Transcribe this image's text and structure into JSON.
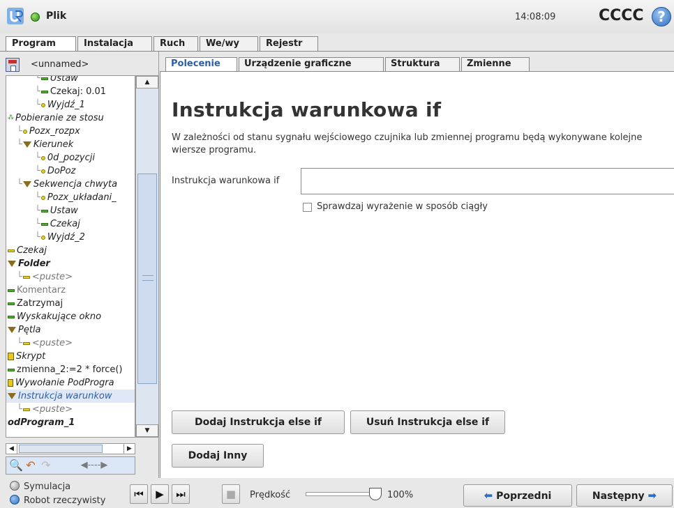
{
  "header": {
    "file_menu": "Plik",
    "clock": "14:08:09",
    "robot_name": "CCCC",
    "help_symbol": "?"
  },
  "main_tabs": [
    "Program",
    "Instalacja",
    "Ruch",
    "We/wy",
    "Rejestr"
  ],
  "program": {
    "name": "<unnamed>"
  },
  "tree": [
    {
      "label": "Ustaw",
      "indent": 3,
      "icon": "bar-icon",
      "style": ""
    },
    {
      "label": "Czekaj: 0.01",
      "indent": 3,
      "icon": "bar-icon",
      "style": "plain"
    },
    {
      "label": "Wyjdź_1",
      "indent": 3,
      "icon": "dot-icon",
      "style": ""
    },
    {
      "label": "Pobieranie ze stosu",
      "indent": 0,
      "icon": "multi-icon",
      "style": ""
    },
    {
      "label": "Pozx_rozpx",
      "indent": 1,
      "icon": "dot-icon",
      "style": ""
    },
    {
      "label": "Kierunek",
      "indent": 1,
      "icon": "triangle-icon",
      "style": ""
    },
    {
      "label": "0d_pozycji",
      "indent": 3,
      "icon": "dot-icon",
      "style": ""
    },
    {
      "label": "DoPoz",
      "indent": 3,
      "icon": "dot-icon",
      "style": ""
    },
    {
      "label": "Sekwencja chwyta",
      "indent": 1,
      "icon": "triangle-icon",
      "style": ""
    },
    {
      "label": "Pozx_układani_",
      "indent": 3,
      "icon": "dot-icon",
      "style": ""
    },
    {
      "label": "Ustaw",
      "indent": 3,
      "icon": "bar-icon",
      "style": ""
    },
    {
      "label": "Czekaj",
      "indent": 3,
      "icon": "bar-icon",
      "style": ""
    },
    {
      "label": "Wyjdź_2",
      "indent": 3,
      "icon": "dot-icon",
      "style": ""
    },
    {
      "label": "Czekaj",
      "indent": 0,
      "icon": "bar-icon-yellow",
      "style": ""
    },
    {
      "label": "Folder",
      "indent": 0,
      "icon": "triangle-icon",
      "style": "bold"
    },
    {
      "label": "<puste>",
      "indent": 1,
      "icon": "bar-icon-yellow",
      "style": "grey"
    },
    {
      "label": "Komentarz",
      "indent": 0,
      "icon": "bar-icon",
      "style": "plain grey"
    },
    {
      "label": "Zatrzymaj",
      "indent": 0,
      "icon": "bar-icon",
      "style": "plain"
    },
    {
      "label": "Wyskakujące okno",
      "indent": 0,
      "icon": "bar-icon",
      "style": ""
    },
    {
      "label": "Pętla",
      "indent": 0,
      "icon": "triangle-icon",
      "style": ""
    },
    {
      "label": "<puste>",
      "indent": 1,
      "icon": "bar-icon-yellow",
      "style": "grey"
    },
    {
      "label": "Skrypt",
      "indent": 0,
      "icon": "script-icon",
      "style": ""
    },
    {
      "label": "zmienna_2:=2 * force()",
      "indent": 0,
      "icon": "bar-icon",
      "style": "plain"
    },
    {
      "label": "Wywołanie PodProgra",
      "indent": 0,
      "icon": "flag-icon",
      "style": ""
    },
    {
      "label": "Instrukcja warunkow",
      "indent": 0,
      "icon": "triangle-icon",
      "style": "sel"
    },
    {
      "label": "<puste>",
      "indent": 1,
      "icon": "bar-icon-yellow",
      "style": "grey"
    },
    {
      "label": "odProgram_1",
      "indent": 0,
      "icon": "none",
      "style": "bold"
    }
  ],
  "tools": {
    "search": "🔍",
    "undo": "↶",
    "redo": "↷",
    "cut": "◀----▶"
  },
  "sub_tabs": [
    "Polecenie",
    "Urządzenie graficzne",
    "Struktura",
    "Zmienne"
  ],
  "command": {
    "title": "Instrukcja warunkowa if",
    "description": "W zależności od stanu sygnału wejściowego czujnika lub zmiennej programu będą wykonywane kolejne wiersze programu.",
    "if_label": "Instrukcja warunkowa if",
    "if_value": "",
    "continuous_label": "Sprawdzaj wyrażenie w sposób ciągły",
    "continuous_checked": false,
    "btn_add_else_if": "Dodaj Instrukcja else if",
    "btn_remove_else_if": "Usuń Instrukcja else if",
    "btn_add_else": "Dodaj Inny"
  },
  "footer": {
    "mode_sim": "Symulacja",
    "mode_real": "Robot rzeczywisty",
    "speed_label": "Prędkość",
    "speed_value": "100%",
    "speed_percent": 100,
    "prev": "Poprzedni",
    "next": "Następny"
  },
  "colors": {
    "accent_blue": "#2e6fc2",
    "selected_text": "#2d5fa8",
    "status_green": "#2c8a16"
  }
}
